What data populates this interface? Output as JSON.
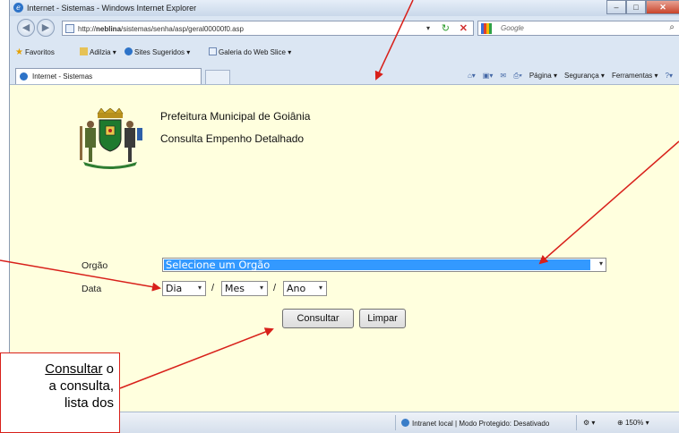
{
  "window": {
    "title": "Internet - Sistemas - Windows Internet Explorer",
    "controls": [
      "minimize-icon",
      "maximize-icon",
      "close-icon"
    ]
  },
  "address": {
    "url_prefix": "http://",
    "url_host": "neblina",
    "url_path": "/sistemas/senha/asp/geral00000f0.asp"
  },
  "search": {
    "placeholder": "Google"
  },
  "favorites": {
    "favorites_label": "Favoritos",
    "items": [
      "Adilzia ▾",
      "Sites Sugeridos ▾",
      "Galeria do Web Slice ▾"
    ]
  },
  "tab": {
    "label": "Internet - Sistemas"
  },
  "commandbar": {
    "pagina": "Página ▾",
    "seguranca": "Segurança ▾",
    "ferramentas": "Ferramentas ▾",
    "help": "?▾"
  },
  "header": {
    "org_name": "Prefeitura Municipal de Goiânia",
    "page_title": "Consulta Empenho Detalhado"
  },
  "form": {
    "orgao_label": "Orgão",
    "orgao_value": "Selecione um Orgão",
    "data_label": "Data",
    "dia_value": "Dia",
    "mes_value": "Mes",
    "ano_value": "Ano",
    "separator": "/",
    "consultar_label": "Consultar",
    "limpar_label": "Limpar"
  },
  "statusbar": {
    "zone_text": "Intranet local | Modo Protegido: Desativado",
    "zoom_value": "150%"
  },
  "callout": {
    "underlined": "Consultar",
    "line1_rest": " o",
    "line2": "a consulta,",
    "line3": "lista dos"
  },
  "colors": {
    "page_bg": "#ffffde",
    "selected_bg": "#3399ff",
    "annotation_red": "#d8201a"
  }
}
